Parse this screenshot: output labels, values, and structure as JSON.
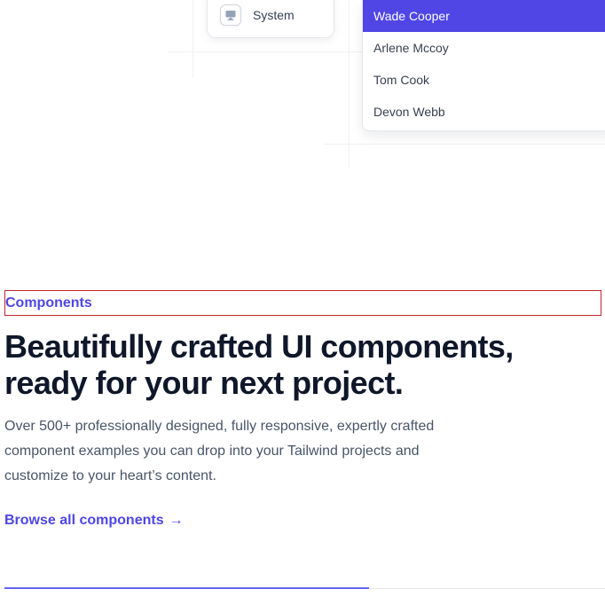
{
  "theme_menu": {
    "option_label": "System",
    "icon": "monitor-icon"
  },
  "listbox": {
    "options": [
      "Wade Cooper",
      "Arlene Mccoy",
      "Tom Cook",
      "Devon Webb"
    ],
    "selected_index": 0
  },
  "hero": {
    "eyebrow": "Components",
    "headline_line1": "Beautifully crafted UI components,",
    "headline_line2": "ready for your next project.",
    "description": "Over 500+ professionally designed, fully responsive, expertly crafted component examples you can drop into your Tailwind projects and customize to your heart’s content.",
    "cta_label": "Browse all components",
    "cta_icon": "arrow-right-icon"
  },
  "progress": {
    "fraction": 0.6
  },
  "colors": {
    "accent": "#4f46e5",
    "heading": "#0f172a",
    "body_text": "#475569",
    "highlight_border": "#c0262d"
  }
}
